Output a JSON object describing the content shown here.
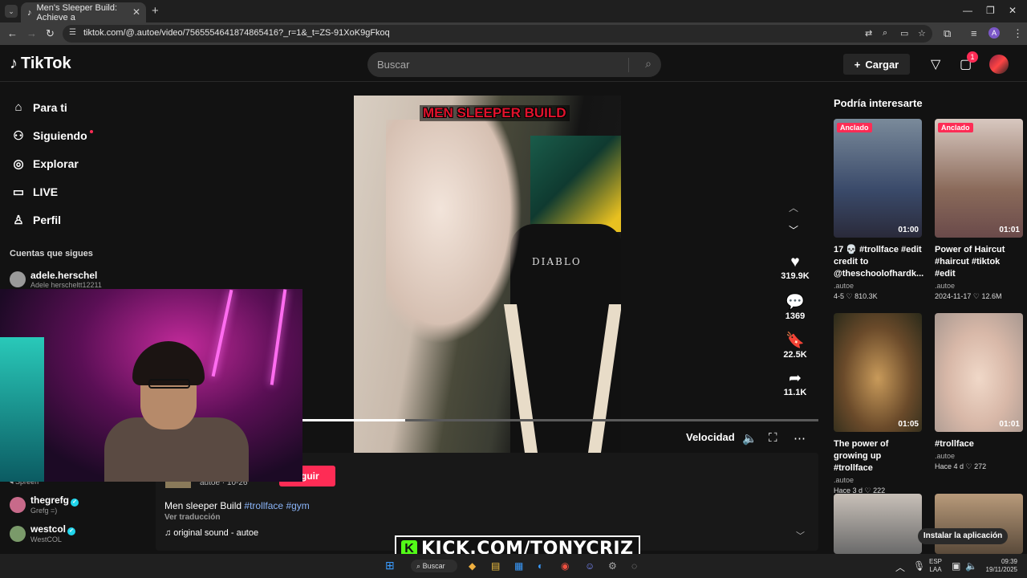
{
  "browser": {
    "tab_title": "Men's Sleeper Build: Achieve a",
    "url": "tiktok.com/@.autoe/video/7565554641874865416?_r=1&_t=ZS-91XoK9gFkoq",
    "profile_letter": "A"
  },
  "header": {
    "logo": "TikTok",
    "search_placeholder": "Buscar",
    "upload_label": "Cargar",
    "inbox_badge": "1"
  },
  "sidebar": {
    "nav": [
      {
        "label": "Para ti",
        "icon": "home-icon"
      },
      {
        "label": "Siguiendo",
        "icon": "users-icon"
      },
      {
        "label": "Explorar",
        "icon": "compass-icon"
      },
      {
        "label": "LIVE",
        "icon": "live-icon"
      },
      {
        "label": "Perfil",
        "icon": "user-icon"
      }
    ],
    "following_title": "Cuentas que sigues",
    "accounts": [
      {
        "name": "adele.herschel",
        "handle": "Adele herscheltt12211"
      },
      {
        "name": "thegrefg",
        "handle": "Grefg =)"
      },
      {
        "name": "westcol",
        "handle": "WestCOL"
      }
    ],
    "partial_label": "Spreen"
  },
  "video": {
    "caption_overlay": "MEN SLEEPER BUILD",
    "chair_brand": "DIABLO",
    "progress": 0.2,
    "speed_label": "Velocidad"
  },
  "actions": {
    "likes": "319.9K",
    "comments": "1369",
    "saves": "22.5K",
    "shares": "11.1K"
  },
  "post": {
    "author_line": "autoe · 10-26",
    "follow_label": "eguir",
    "desc_text": "Men sleeper Build ",
    "tag1": "#trollface",
    "tag2": "#gym",
    "translate": "Ver traducción",
    "sound": "♫ original sound - autoe"
  },
  "recommendations": {
    "title": "Podría interesarte",
    "cards": [
      {
        "pinned": "Anclado",
        "duration": "01:00",
        "title": "17 💀 #trollface #edit credit to @theschoolofhardk...",
        "author": ".autoe",
        "date": "4-5",
        "likes": "810.3K"
      },
      {
        "pinned": "Anclado",
        "duration": "01:01",
        "title": "Power of Haircut #haircut #tiktok #edit",
        "author": ".autoe",
        "date": "2024-11-17",
        "likes": "12.6M"
      },
      {
        "pinned": "",
        "duration": "01:05",
        "title": "The power of growing up #trollface",
        "author": ".autoe",
        "date": "Hace 3 d",
        "likes": "222"
      },
      {
        "pinned": "",
        "duration": "01:01",
        "title": "#trollface",
        "author": ".autoe",
        "date": "Hace 4 d",
        "likes": "272"
      }
    ],
    "install_label": "Instalar la aplicación"
  },
  "overlay": {
    "kick_text": "KICK.COM/TONYCRIZ"
  },
  "taskbar": {
    "search_label": "Buscar",
    "lang": "ESP",
    "lang2": "LAA",
    "time": "09:39",
    "date": "19/11/2025"
  },
  "colors": {
    "accent": "#fe2c55",
    "hashtag": "#8ab4f8",
    "kick_green": "#53fc18"
  }
}
